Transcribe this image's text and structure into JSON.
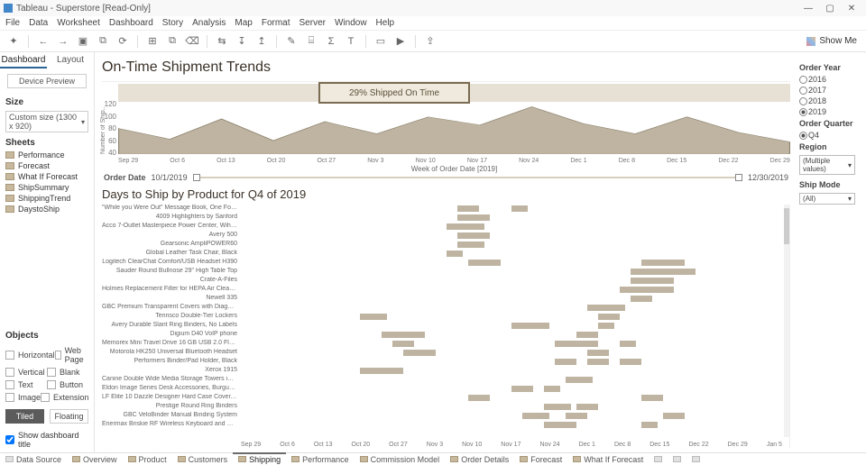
{
  "window": {
    "title": "Tableau - Superstore [Read-Only]"
  },
  "menu": [
    "File",
    "Data",
    "Worksheet",
    "Dashboard",
    "Story",
    "Analysis",
    "Map",
    "Format",
    "Server",
    "Window",
    "Help"
  ],
  "showme": "Show Me",
  "left": {
    "tabs": {
      "dashboard": "Dashboard",
      "layout": "Layout"
    },
    "device_preview": "Device Preview",
    "size_header": "Size",
    "size_value": "Custom size (1300 x 920)",
    "sheets_header": "Sheets",
    "sheets": [
      "Performance",
      "Forecast",
      "What If Forecast",
      "ShipSummary",
      "ShippingTrend",
      "DaystoShip"
    ],
    "objects_header": "Objects",
    "objects": [
      [
        "Horizontal",
        "Web Page"
      ],
      [
        "Vertical",
        "Blank"
      ],
      [
        "Text",
        "Button"
      ],
      [
        "Image",
        "Extension"
      ]
    ],
    "tiled": "Tiled",
    "floating": "Floating",
    "show_title": "Show dashboard title"
  },
  "dash": {
    "title": "On-Time Shipment Trends",
    "badge": "29% Shipped On Time",
    "yticks": [
      "120",
      "100",
      "80",
      "60",
      "40"
    ],
    "ylabel": "Number of Ship..",
    "xticks": [
      "Sep 29",
      "Oct 6",
      "Oct 13",
      "Oct 20",
      "Oct 27",
      "Nov 3",
      "Nov 10",
      "Nov 17",
      "Nov 24",
      "Dec 1",
      "Dec 8",
      "Dec 15",
      "Dec 22",
      "Dec 29"
    ],
    "xtitle": "Week of Order Date [2019]",
    "order_date_label": "Order Date",
    "order_date_from": "10/1/2019",
    "order_date_to": "12/30/2019",
    "subtitle": "Days to Ship by Product for Q4 of 2019",
    "gantt_rows": [
      "\"While you Were Out\" Message Book, One Form pe..",
      "4009 Highlighters by Sanford",
      "Acco 7-Outlet Masterpiece Power Center, Wihtout..",
      "Avery 500",
      "Gearsonic AmpliPOWER60",
      "Global Leather Task Chair, Black",
      "Logitech ClearChat Comfort/USB Headset H390",
      "Sauder Round Bullnose 29\" High Table Top",
      "Crate-A-Files",
      "Holmes Replacement Filter for HEPA Air Cleaner, ..",
      "Newell 335",
      "GBC Premium Transparent Covers with Diagonal Li..",
      "Tennsco Double-Tier Lockers",
      "Avery Durable Slant Ring Binders, No Labels",
      "Digium D40 VoIP phone",
      "Memorex Mini Travel Drive 16 GB USB 2.0 Flash Dri..",
      "Motorola HK250 Universal Bluetooth Headset",
      "Performers Binder/Pad Holder, Black",
      "Xerox 1915",
      "Canine Double Wide Media Storage Towers in Natu..",
      "Eldon Image Series Desk Accessories, Burgundy",
      "LF Elite 10 Dazzle Designer Hard Case Cover, LF Sty..",
      "Prestige Round Ring Binders",
      "GBC VeloBinder Manual Binding System",
      "Enermax Briskie RF Wireless Keyboard and Mouse"
    ],
    "xticks2": [
      "Sep 29",
      "Oct 6",
      "Oct 13",
      "Oct 20",
      "Oct 27",
      "Nov 3",
      "Nov 10",
      "Nov 17",
      "Nov 24",
      "Dec 1",
      "Dec 8",
      "Dec 15",
      "Dec 22",
      "Dec 29",
      "Jan 5"
    ]
  },
  "filters": {
    "order_year_h": "Order Year",
    "years": [
      "2016",
      "2017",
      "2018",
      "2019"
    ],
    "selected_year": "2019",
    "order_quarter_h": "Order Quarter",
    "quarter": "Q4",
    "region_h": "Region",
    "region_val": "(Multiple values)",
    "ship_mode_h": "Ship Mode",
    "ship_mode_val": "(All)"
  },
  "bottom_tabs": {
    "data_source": "Data Source",
    "tabs": [
      "Overview",
      "Product",
      "Customers",
      "Shipping",
      "Performance",
      "Commission Model",
      "Order Details",
      "Forecast",
      "What If Forecast"
    ],
    "active": 3
  },
  "chart_data": {
    "type": "area",
    "title": "On-Time Shipment Trends",
    "ylabel": "Number of Shipments",
    "ylim": [
      40,
      120
    ],
    "categories": [
      "Sep 29",
      "Oct 6",
      "Oct 13",
      "Oct 20",
      "Oct 27",
      "Nov 3",
      "Nov 10",
      "Nov 17",
      "Nov 24",
      "Dec 1",
      "Dec 8",
      "Dec 15",
      "Dec 22",
      "Dec 29"
    ],
    "values": [
      78,
      62,
      92,
      60,
      88,
      70,
      95,
      83,
      110,
      85,
      70,
      95,
      72,
      58
    ]
  }
}
